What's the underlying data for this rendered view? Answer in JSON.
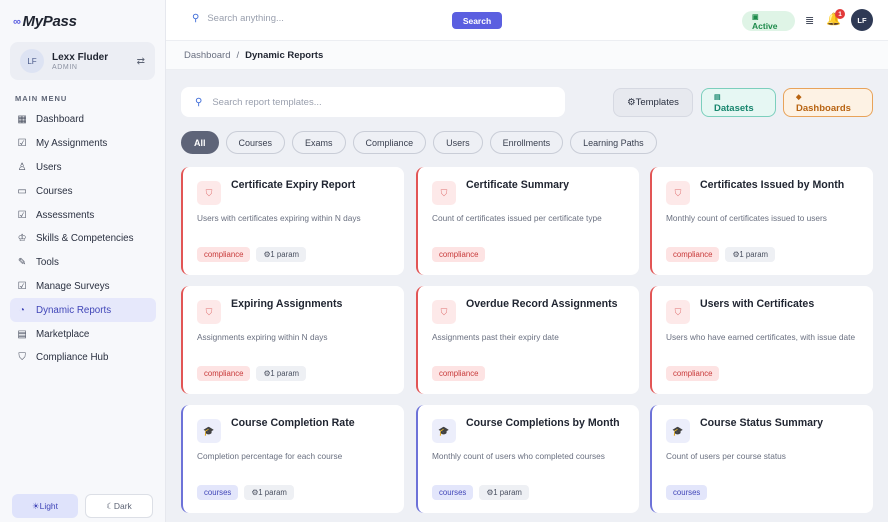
{
  "app": {
    "logo_icon": "∞",
    "logo_text": "MyPass"
  },
  "user": {
    "initials": "LF",
    "name": "Lexx Fluder",
    "role": "ADMIN",
    "switch_icon": "⇄"
  },
  "sidebar": {
    "section_label": "MAIN MENU",
    "items": [
      {
        "label": "Dashboard",
        "icon": "▦"
      },
      {
        "label": "My Assignments",
        "icon": "☑"
      },
      {
        "label": "Users",
        "icon": "♙"
      },
      {
        "label": "Courses",
        "icon": "▭"
      },
      {
        "label": "Assessments",
        "icon": "☑"
      },
      {
        "label": "Skills & Competencies",
        "icon": "♔"
      },
      {
        "label": "Tools",
        "icon": "✎"
      },
      {
        "label": "Manage Surveys",
        "icon": "☑"
      },
      {
        "label": "Dynamic Reports",
        "icon": "◔"
      },
      {
        "label": "Marketplace",
        "icon": "▤"
      },
      {
        "label": "Compliance Hub",
        "icon": "⛉"
      }
    ],
    "active_item": "Dynamic Reports",
    "theme_light": "☀Light",
    "theme_dark": "☾Dark"
  },
  "header": {
    "search_placeholder": "Search anything...",
    "search_button": "Search",
    "status_icon": "▣",
    "status_label": "Active",
    "menu_icon": "≣",
    "bell_icon": "🔔",
    "notification_count": "1",
    "avatar_initials": "LF"
  },
  "breadcrumb": {
    "root": "Dashboard",
    "separator": "/",
    "current": "Dynamic Reports"
  },
  "toolbar": {
    "search_placeholder": "Search report templates...",
    "templates_label": "⚙Templates",
    "datasets_icon": "▤",
    "datasets_label": "Datasets",
    "dashboards_icon": "◆",
    "dashboards_label": "Dashboards"
  },
  "filters": [
    "All",
    "Courses",
    "Exams",
    "Compliance",
    "Users",
    "Enrollments",
    "Learning Paths"
  ],
  "active_filter": "All",
  "cards": [
    {
      "title": "Certificate Expiry Report",
      "description": "Users with certificates expiring within N days",
      "category": "compliance",
      "param": "⚙1 param",
      "icon": "⛉"
    },
    {
      "title": "Certificate Summary",
      "description": "Count of certificates issued per certificate type",
      "category": "compliance",
      "param": "",
      "icon": "⛉"
    },
    {
      "title": "Certificates Issued by Month",
      "description": "Monthly count of certificates issued to users",
      "category": "compliance",
      "param": "⚙1 param",
      "icon": "⛉"
    },
    {
      "title": "Expiring Assignments",
      "description": "Assignments expiring within N days",
      "category": "compliance",
      "param": "⚙1 param",
      "icon": "⛉"
    },
    {
      "title": "Overdue Record Assignments",
      "description": "Assignments past their expiry date",
      "category": "compliance",
      "param": "",
      "icon": "⛉"
    },
    {
      "title": "Users with Certificates",
      "description": "Users who have earned certificates, with issue date",
      "category": "compliance",
      "param": "",
      "icon": "⛉"
    },
    {
      "title": "Course Completion Rate",
      "description": "Completion percentage for each course",
      "category": "courses",
      "param": "⚙1 param",
      "icon": "🎓"
    },
    {
      "title": "Course Completions by Month",
      "description": "Monthly count of users who completed courses",
      "category": "courses",
      "param": "⚙1 param",
      "icon": "🎓"
    },
    {
      "title": "Course Status Summary",
      "description": "Count of users per course status",
      "category": "courses",
      "param": "",
      "icon": "🎓"
    }
  ],
  "colors": {
    "accent": "#5b5fe0",
    "compliance": "#e25555",
    "courses": "#6d72d8",
    "datasets": "#18866e",
    "dashboards": "#b86412"
  }
}
